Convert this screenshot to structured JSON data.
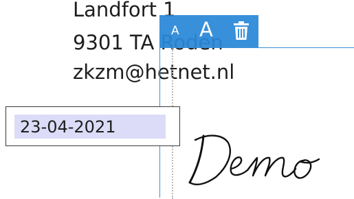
{
  "address": {
    "street": "Landfort 1",
    "postal": "9301 TA Roden",
    "email": "zkzm@hetnet.nl"
  },
  "toolbar": {
    "smaller_text_label": "A",
    "larger_text_label": "A",
    "delete_icon": "trash-icon",
    "background_color": "#2b88d8"
  },
  "date_field": {
    "value": "23-04-2021",
    "highlight_color": "#dcdcf8"
  },
  "signature": {
    "text": "Demo"
  },
  "colors": {
    "selection": "#3e8ed6",
    "text": "#1e1e1e"
  }
}
